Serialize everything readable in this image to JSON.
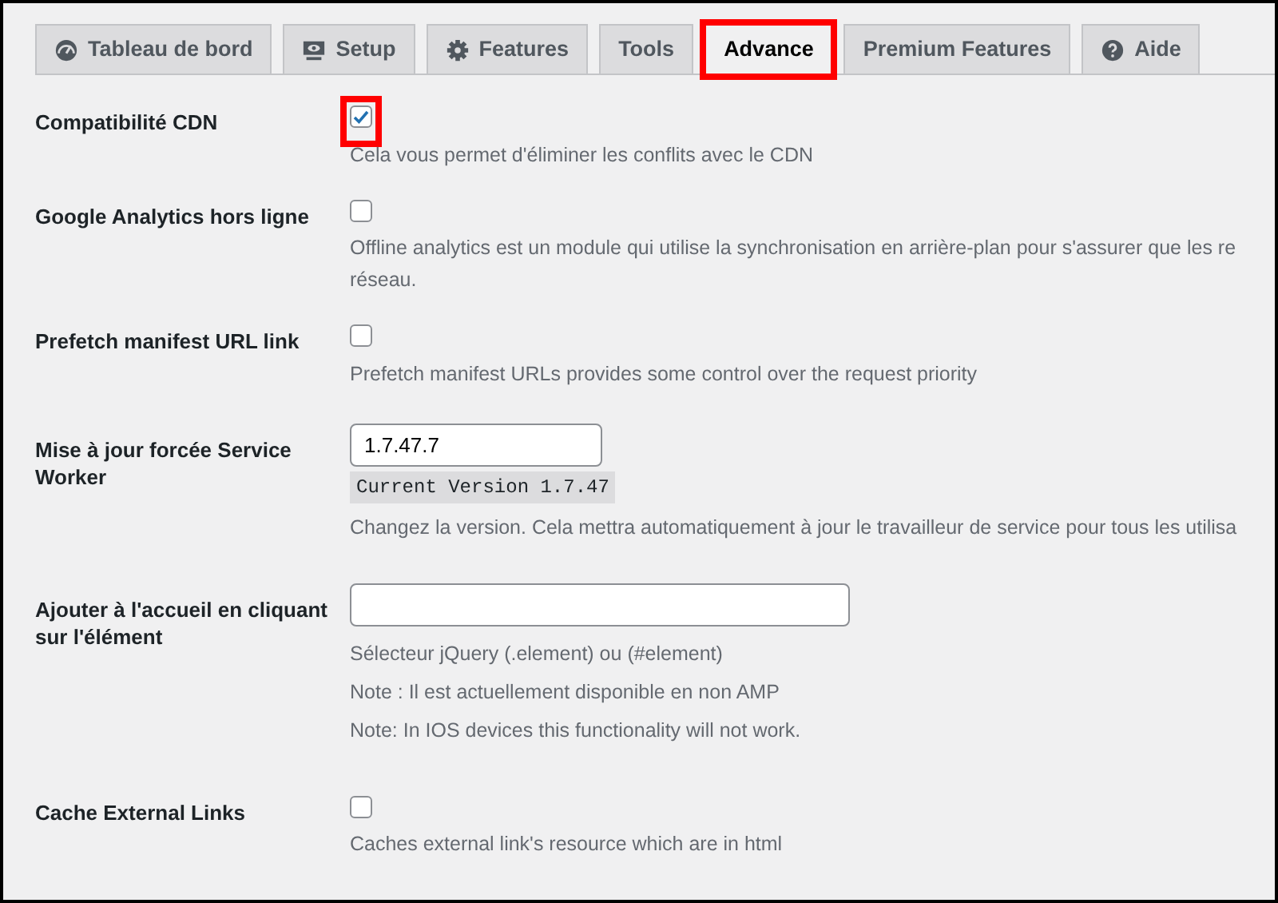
{
  "tabs": [
    {
      "label": "Tableau de bord",
      "kind": "gauge",
      "selected": false,
      "highlighted": false
    },
    {
      "label": "Setup",
      "kind": "monitor",
      "selected": false,
      "highlighted": false
    },
    {
      "label": "Features",
      "kind": "gear",
      "selected": false,
      "highlighted": false
    },
    {
      "label": "Tools",
      "kind": "plain",
      "selected": false,
      "highlighted": false
    },
    {
      "label": "Advance",
      "kind": "plain",
      "selected": true,
      "highlighted": true
    },
    {
      "label": "Premium Features",
      "kind": "plain",
      "selected": false,
      "highlighted": false
    },
    {
      "label": "Aide",
      "kind": "help",
      "selected": false,
      "highlighted": false
    }
  ],
  "settings": [
    {
      "label": "Compatibilité CDN",
      "kind": "checkbox",
      "checked": true,
      "highlighted": true,
      "descriptions": [
        "Cela vous permet d'éliminer les conflits avec le CDN"
      ]
    },
    {
      "label": "Google Analytics hors ligne",
      "kind": "checkbox",
      "checked": false,
      "highlighted": false,
      "descriptions": [
        "Offline analytics est un module qui utilise la synchronisation en arrière-plan pour s'assurer que les re",
        "réseau."
      ]
    },
    {
      "label": "Prefetch manifest URL link",
      "kind": "checkbox",
      "checked": false,
      "highlighted": false,
      "descriptions": [
        "Prefetch manifest URLs provides some control over the request priority"
      ]
    },
    {
      "label": "Mise à jour forcée Service Worker",
      "kind": "text",
      "value": "1.7.47.7",
      "code": "Current Version 1.7.47",
      "descriptions": [
        "Changez la version. Cela mettra automatiquement à jour le travailleur de service pour tous les utilisa"
      ]
    },
    {
      "label": "Ajouter à l'accueil en cliquant sur l'élément",
      "kind": "wide-text",
      "descriptions": [
        "Sélecteur jQuery (.element) ou (#element)",
        "Note : Il est actuellement disponible en non AMP",
        "Note: In IOS devices this functionality will not work."
      ]
    },
    {
      "label": "Cache External Links",
      "kind": "checkbox",
      "checked": false,
      "highlighted": false,
      "descriptions": [
        "Caches external link's resource which are in html"
      ]
    }
  ]
}
